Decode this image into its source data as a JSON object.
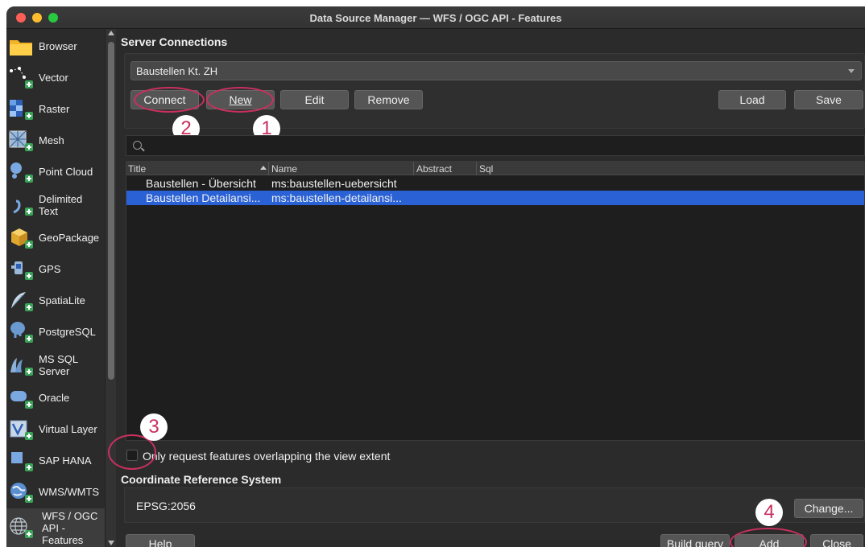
{
  "window": {
    "title": "Data Source Manager — WFS / OGC API - Features"
  },
  "sidebar": {
    "items": [
      {
        "label": "Browser",
        "icon": "folder-icon"
      },
      {
        "label": "Vector",
        "icon": "vector-icon"
      },
      {
        "label": "Raster",
        "icon": "raster-icon"
      },
      {
        "label": "Mesh",
        "icon": "mesh-icon"
      },
      {
        "label": "Point Cloud",
        "icon": "point-cloud-icon"
      },
      {
        "label": "Delimited\nText",
        "icon": "delimited-text-icon"
      },
      {
        "label": "GeoPackage",
        "icon": "geopackage-icon"
      },
      {
        "label": "GPS",
        "icon": "gps-icon"
      },
      {
        "label": "SpatiaLite",
        "icon": "spatialite-icon"
      },
      {
        "label": "PostgreSQL",
        "icon": "postgresql-icon"
      },
      {
        "label": "MS SQL\nServer",
        "icon": "mssql-icon"
      },
      {
        "label": "Oracle",
        "icon": "oracle-icon"
      },
      {
        "label": "Virtual Layer",
        "icon": "virtual-layer-icon"
      },
      {
        "label": "SAP HANA",
        "icon": "sap-hana-icon"
      },
      {
        "label": "WMS/WMTS",
        "icon": "wms-icon"
      },
      {
        "label": "WFS / OGC\nAPI -\nFeatures",
        "icon": "wfs-icon"
      }
    ]
  },
  "server": {
    "section_title": "Server Connections",
    "connection_value": "Baustellen Kt. ZH",
    "buttons": {
      "connect": "Connect",
      "new": "New",
      "edit": "Edit",
      "remove": "Remove",
      "load": "Load",
      "save": "Save"
    }
  },
  "table": {
    "columns": [
      "Title",
      "Name",
      "Abstract",
      "Sql"
    ],
    "rows": [
      {
        "title": "Baustellen - Übersicht",
        "name": "ms:baustellen-uebersicht",
        "selected": false
      },
      {
        "title": "Baustellen Detailansi...",
        "name": "ms:baustellen-detailansi...",
        "selected": true
      }
    ]
  },
  "options": {
    "extent_label": "Only request features overlapping the view extent"
  },
  "crs": {
    "section_title": "Coordinate Reference System",
    "value": "EPSG:2056",
    "change_label": "Change..."
  },
  "footer": {
    "help": "Help",
    "build_query": "Build query",
    "add": "Add",
    "close": "Close"
  },
  "annotations": {
    "badge_1": "1",
    "badge_2": "2",
    "badge_3": "3",
    "badge_4": "4",
    "accent_color": "#c9305f"
  },
  "colors": {
    "selection": "#2a62d6",
    "background": "#2b2b2b"
  }
}
